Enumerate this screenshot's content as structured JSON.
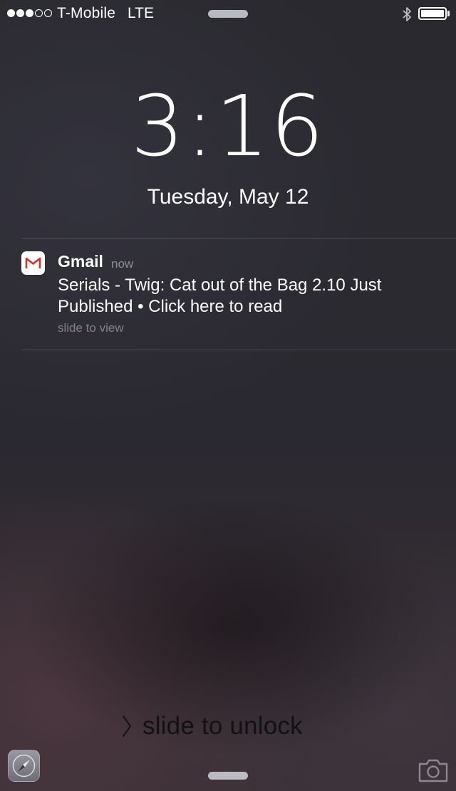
{
  "status_bar": {
    "signal_bars_filled": 3,
    "signal_bars_total": 5,
    "carrier": "T-Mobile",
    "network": "LTE",
    "bluetooth_icon": "bluetooth-icon",
    "battery_level_percent": 100
  },
  "lock_screen": {
    "time": "3:16",
    "date": "Tuesday, May 12"
  },
  "notification": {
    "app_icon": "gmail-icon",
    "app_name": "Gmail",
    "timestamp": "now",
    "body": "Serials - Twig: Cat out of the Bag 2.10 Just Published  •  Click here to read",
    "hint": "slide to view"
  },
  "unlock": {
    "label": "slide to unlock",
    "icon": "chevron-right-icon"
  },
  "bottom": {
    "left_icon": "safari-compass-icon",
    "right_icon": "camera-icon"
  },
  "colors": {
    "gmail_red": "#d93025",
    "unlock_text": "#121114"
  }
}
